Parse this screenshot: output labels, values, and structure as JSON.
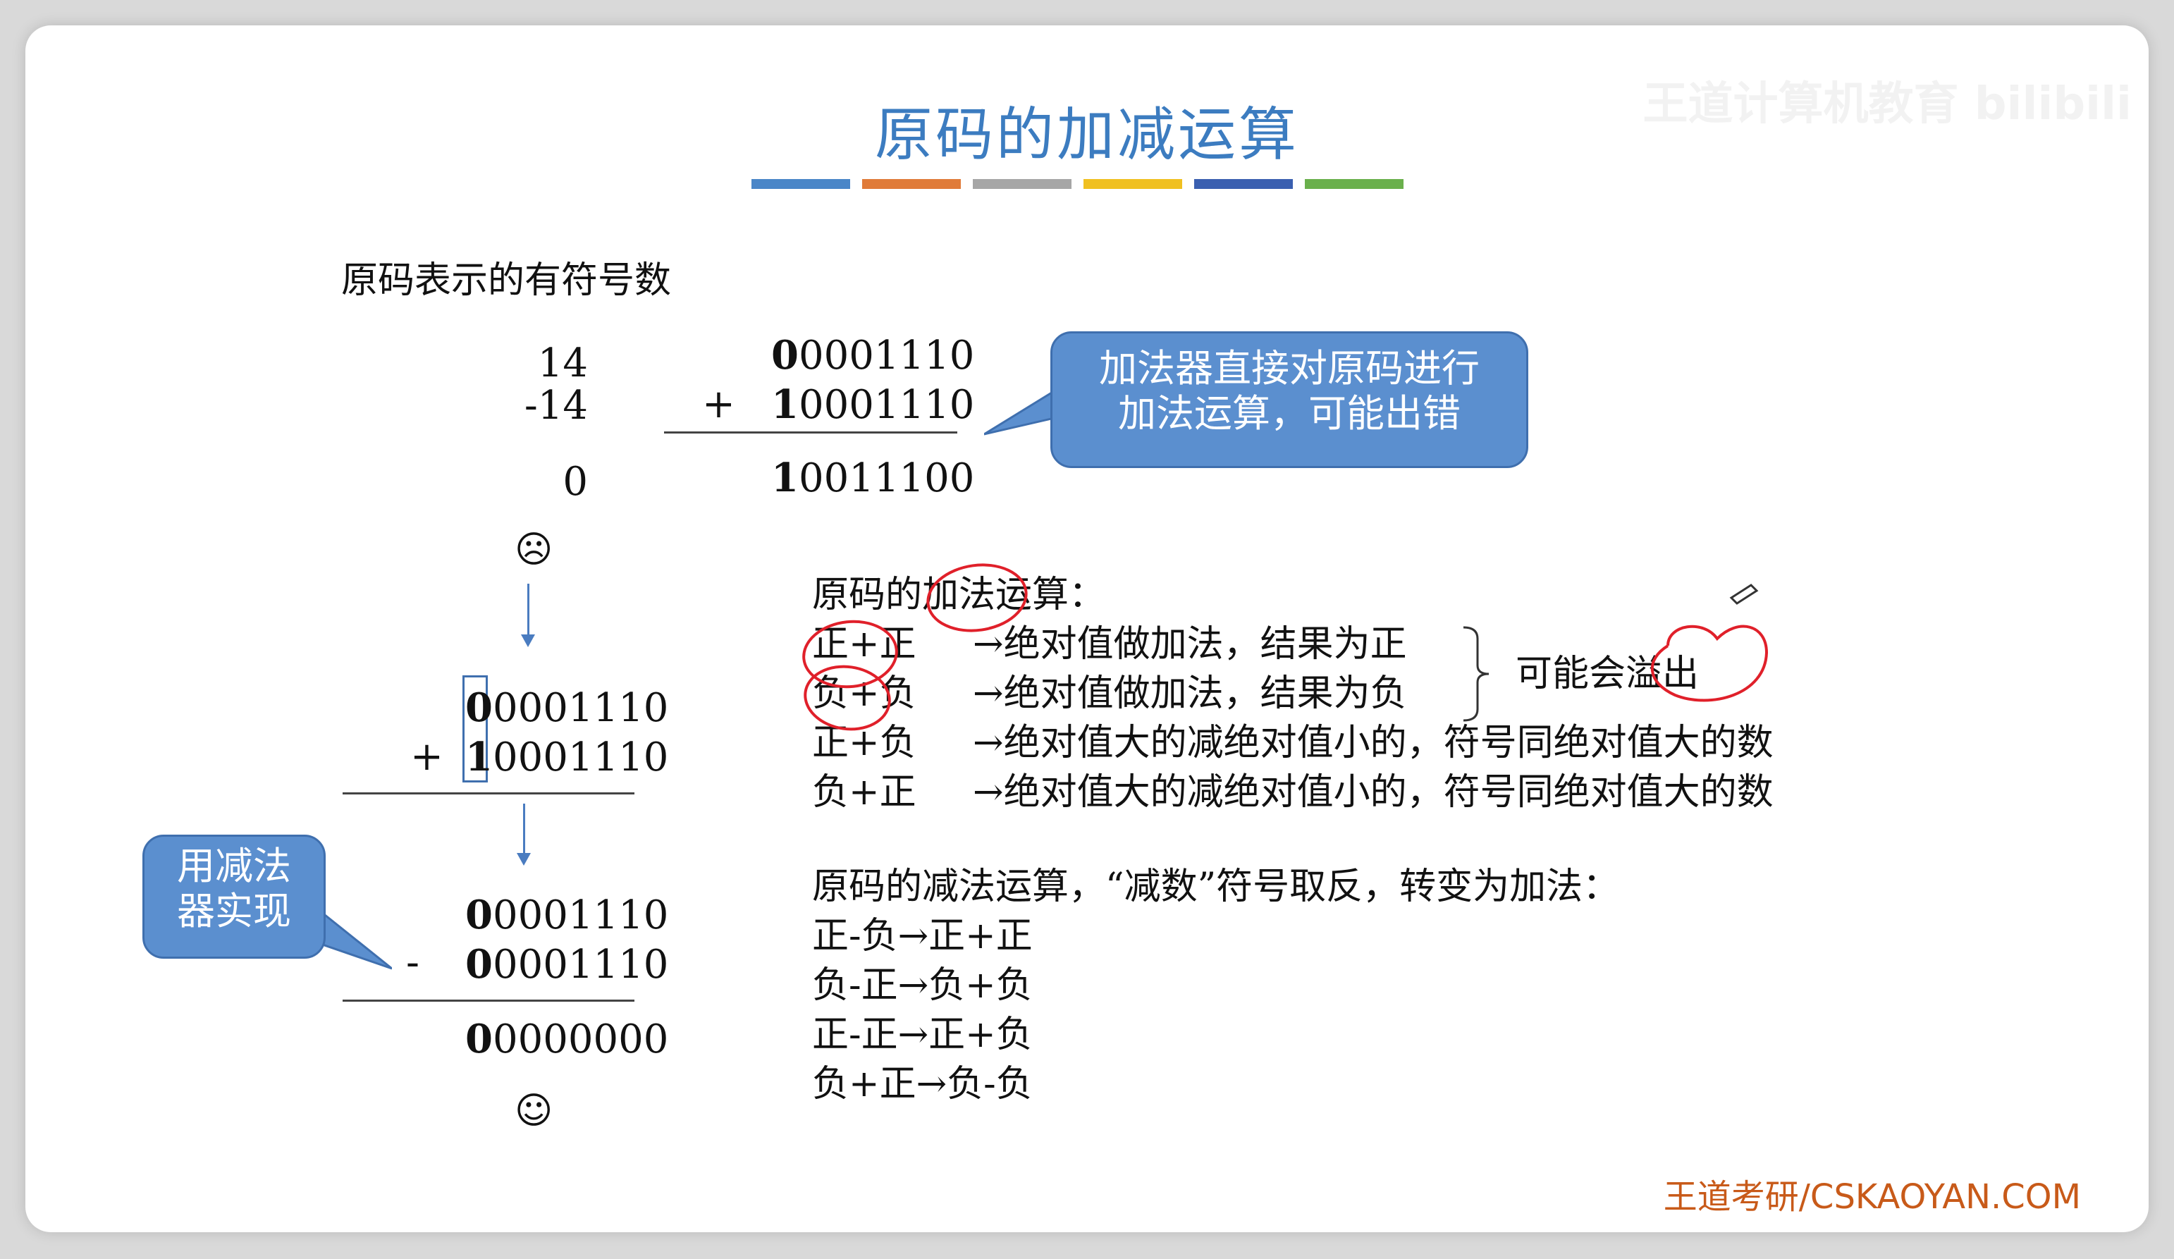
{
  "slide": {
    "title": "原码的加减运算",
    "watermark": "王道计算机教育 bilibili",
    "bar_colors": [
      "#4a86c8",
      "#e07b39",
      "#a6a6a6",
      "#f0c020",
      "#3a5fb0",
      "#6ab04c"
    ],
    "footer": "王道考研/CSKAOYAN.COM"
  },
  "section": {
    "heading": "原码表示的有符号数"
  },
  "example1": {
    "dec_a": "14",
    "dec_b": "-14",
    "dec_result": "0",
    "bin_a": "00001110",
    "bin_b": "10001110",
    "bin_result": "10011100",
    "op": "+",
    "face": "☹"
  },
  "callout_top": {
    "line1": "加法器直接对原码进行",
    "line2": "加法运算，可能出错"
  },
  "example2": {
    "sum_a_first": "0",
    "sum_a_rest": "0001110",
    "sum_b_first": "1",
    "sum_b_rest": "0001110",
    "sum_op": "+",
    "sub_a": "00001110",
    "sub_b": "00001110",
    "sub_op": "-",
    "sub_result": "00000000",
    "face": "☺"
  },
  "callout_left": {
    "line1": "用减法",
    "line2": "器实现"
  },
  "rules": {
    "add_heading": "原码的加法运算：",
    "rows": [
      {
        "case": "正+正",
        "result": "→绝对值做加法，结果为正"
      },
      {
        "case": "负+负",
        "result": "→绝对值做加法，结果为负"
      },
      {
        "case": "正+负",
        "result": "→绝对值大的减绝对值小的，符号同绝对值大的数"
      },
      {
        "case": "负+正",
        "result": "→绝对值大的减绝对值小的，符号同绝对值大的数"
      }
    ],
    "bracket_note": "可能会溢出",
    "sub_heading": "原码的减法运算，“减数”符号取反，转变为加法：",
    "sub_rows": [
      "正-负→正+正",
      "负-正→负+负",
      "正-正→正+负",
      "负+正→负-负"
    ]
  }
}
